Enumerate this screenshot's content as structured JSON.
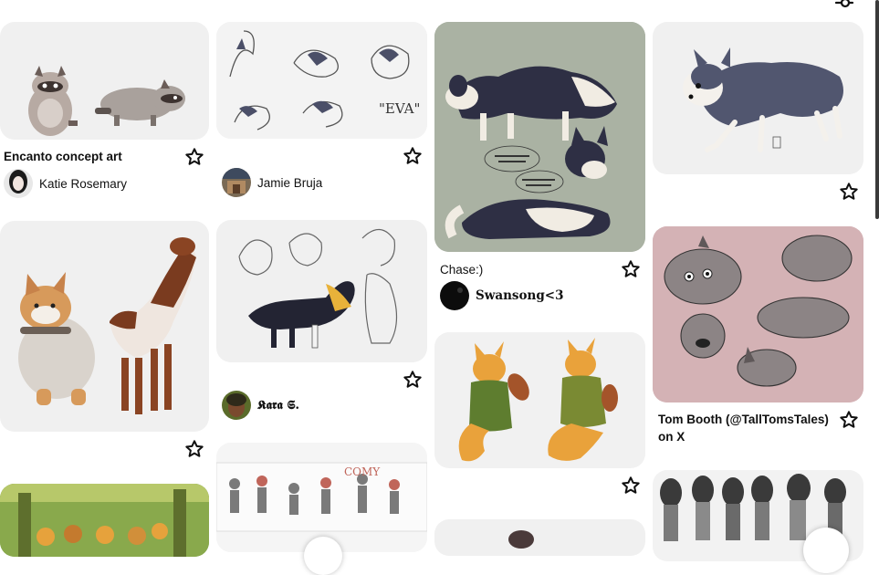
{
  "pins": [
    {
      "id": "encanto",
      "title": "Encanto concept art",
      "author": "Katie Rosemary"
    },
    {
      "id": "eva",
      "title": "",
      "author": "Jamie Bruja"
    },
    {
      "id": "chase",
      "title": "Chase:)",
      "author": "Swansong<3"
    },
    {
      "id": "bluedog",
      "title": "",
      "author": ""
    },
    {
      "id": "corgi-hound",
      "title": "",
      "author": ""
    },
    {
      "id": "collie-sketch",
      "title": "",
      "author": "𝕶𝖆𝖗𝖆 𝕾."
    },
    {
      "id": "fox-violin",
      "title": "",
      "author": ""
    },
    {
      "id": "tom-booth-dogs",
      "title": "Tom Booth (@TallTomsTales) on X",
      "author": ""
    },
    {
      "id": "forest-kids",
      "title": "",
      "author": ""
    },
    {
      "id": "character-sheet",
      "title": "",
      "author": ""
    },
    {
      "id": "bottom-pin",
      "title": "",
      "author": ""
    },
    {
      "id": "girls-lineup",
      "title": "",
      "author": ""
    }
  ],
  "colors": {
    "card_bg": "#f0f0f0",
    "pink_card": "#d5b3b6",
    "sage_card": "#a9b1a2",
    "text": "#111111"
  },
  "icons": {
    "save": "star-icon",
    "filter": "filter-icon"
  }
}
